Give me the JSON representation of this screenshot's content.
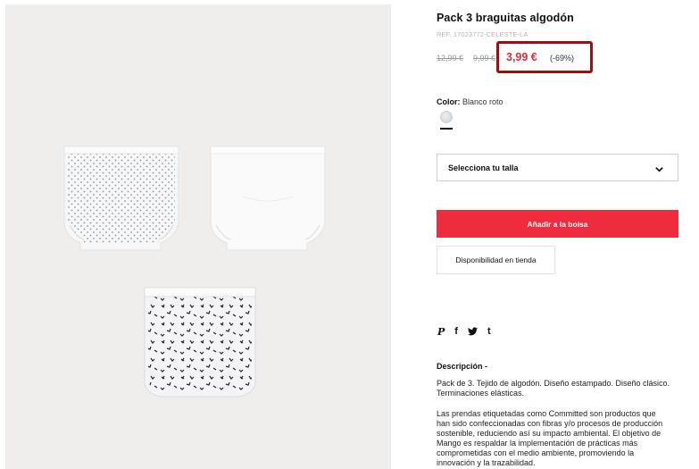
{
  "product": {
    "title": "Pack 3 braguitas algodón",
    "ref": "REF. 17023772-CELESTE-LA",
    "old_price_1": "12,99 €",
    "old_price_2": "9,99 €",
    "current_price": "3,99 €",
    "discount": "(-69%)",
    "highlight_color": "#9e0d10",
    "price_color": "#e02b3d"
  },
  "color": {
    "label": "Color:",
    "value": "Blanco roto"
  },
  "size_select": {
    "label": "Selecciona tu talla",
    "icon": "chevron-down-icon"
  },
  "actions": {
    "add_to_bag": "Añadir a la bolsa",
    "add_to_bag_color": "#ef2b3e",
    "availability": "Disponibilidad en tienda"
  },
  "social": {
    "icons": [
      "pinterest-icon",
      "facebook-icon",
      "twitter-icon",
      "tumblr-icon"
    ],
    "pinterest": "P",
    "facebook": "f",
    "tumblr": "t"
  },
  "description": {
    "heading": "Descripción  -",
    "paragraph_1": "Pack de 3. Tejido de algodón. Diseño estampado. Diseño clásico. Terminaciones elásticas.",
    "paragraph_2": "Las prendas etiquetadas como Committed son productos que han sido confeccionadas con fibras y/o procesos de producción sostenible, reduciendo así su impacto ambiental. El objetivo de Mango es respaldar la implementación de prácticas más comprometidas con el medio ambiente, promoviendo la innovación y la trazabilidad."
  }
}
